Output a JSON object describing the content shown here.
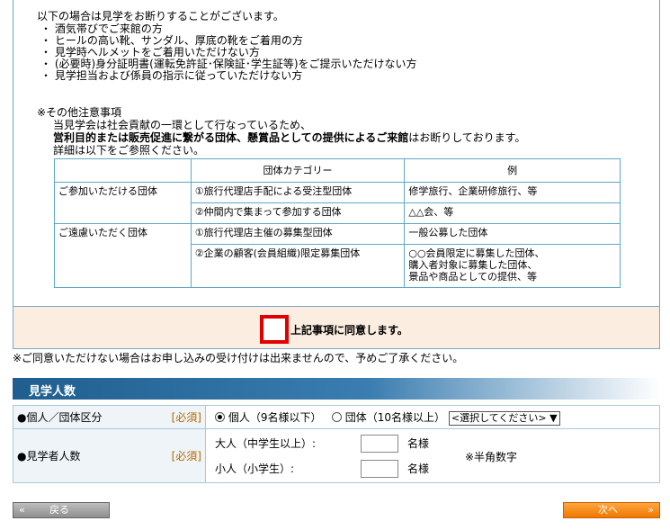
{
  "notice": {
    "refusal_intro": "以下の場合は見学をお断りすることがございます。",
    "refusal_items": [
      "・ 酒気帯びでご来館の方",
      "・ ヒールの高い靴、サンダル、厚底の靴をご着用の方",
      "・ 見学時ヘルメットをご着用いただけない方",
      "・ (必要時)身分証明書(運転免許証･保険証･学生証等)をご提示いただけない方",
      "・ 見学担当および係員の指示に従っていただけない方"
    ],
    "other_title": "※その他注意事項",
    "other_line1": "当見学会は社会貢献の一環として行なっているため、",
    "other_line2_bold": "営利目的または販売促進に繋がる団体、懸賞品としての提供によるご来館",
    "other_line2_rest": "はお断りしております。",
    "other_line3": "詳細は以下をご参照ください。"
  },
  "category_table": {
    "headers": [
      "",
      "団体カテゴリー",
      "例"
    ],
    "group_ok": "ご参加いただける団体",
    "group_ng": "ご遠慮いただく団体",
    "rows": [
      {
        "cat": "①旅行代理店手配による受注型団体",
        "ex": "修学旅行、企業研修旅行、等"
      },
      {
        "cat": "②仲間内で集まって参加する団体",
        "ex": "△△会、等"
      },
      {
        "cat": "①旅行代理店主催の募集型団体",
        "ex": "一般公募した団体"
      },
      {
        "cat": "②企業の顧客(会員組織)限定募集団体",
        "ex_lines": [
          "○○会員限定に募集した団体、",
          "購入者対象に募集した団体、",
          "景品や商品としての提供、等"
        ]
      }
    ]
  },
  "agree": {
    "label": "上記事項に同意します。",
    "note": "※ご同意いただけない場合はお申し込みの受け付けは出来ませんので、予めご了承ください。"
  },
  "section": {
    "title": "見学人数"
  },
  "form": {
    "type_label": "●個人／団体区分",
    "required": "[必須]",
    "opt_individual": "個人（9名様以下）",
    "opt_group": "団体（10名様以上）",
    "select_value": "<選択してください>",
    "count_label": "●見学者人数",
    "adult_label": "大人（中学生以上）:",
    "child_label": "小人（小学生）:",
    "unit": "名様",
    "hint": "※半角数字"
  },
  "nav": {
    "back": "戻る",
    "next": "次へ"
  }
}
